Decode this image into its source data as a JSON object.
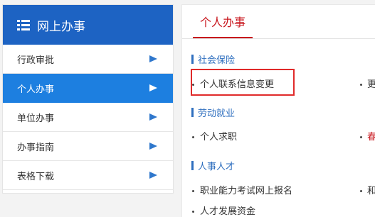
{
  "sidebar": {
    "title": "网上办事",
    "items": [
      {
        "label": "行政审批"
      },
      {
        "label": "个人办事"
      },
      {
        "label": "单位办事"
      },
      {
        "label": "办事指南"
      },
      {
        "label": "表格下载"
      }
    ],
    "active_index": 1
  },
  "main": {
    "tab": "个人办事",
    "sections": [
      {
        "title": "社会保险",
        "items": [
          "个人联系信息变更"
        ],
        "cut_off_right": "更"
      },
      {
        "title": "劳动就业",
        "items": [
          "个人求职"
        ],
        "cut_off_right": "春"
      },
      {
        "title": "人事人才",
        "items": [
          "职业能力考试网上报名",
          "人才发展资金"
        ],
        "cut_off_right": "和"
      }
    ]
  },
  "colors": {
    "header_blue": "#1d63c3",
    "active_blue": "#1d7fe0",
    "tab_red": "#c8161d",
    "section_blue": "#2f6fbf",
    "highlight_red": "#e02a2a"
  }
}
